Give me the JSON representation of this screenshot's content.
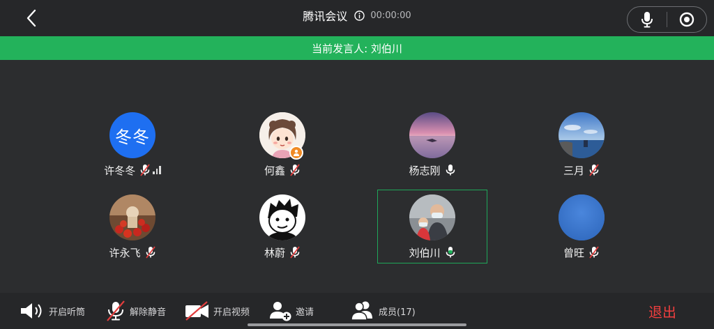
{
  "header": {
    "title": "腾讯会议",
    "timer": "00:00:00"
  },
  "speaker_bar": {
    "text": "当前发言人: 刘伯川"
  },
  "participants": [
    {
      "name": "许冬冬",
      "avatar_text": "冬冬",
      "mic": "muted",
      "signal": true
    },
    {
      "name": "何鑫",
      "mic": "muted",
      "host_badge": true
    },
    {
      "name": "杨志刚",
      "mic": "on"
    },
    {
      "name": "三月",
      "mic": "muted"
    },
    {
      "name": "许永飞",
      "mic": "muted"
    },
    {
      "name": "林蔚",
      "mic": "muted"
    },
    {
      "name": "刘伯川",
      "mic": "speaking",
      "active": true
    },
    {
      "name": "曾旺",
      "mic": "muted"
    }
  ],
  "toolbar": {
    "speaker_label": "开启听筒",
    "unmute_label": "解除静音",
    "video_label": "开启视频",
    "invite_label": "邀请",
    "members_label": "成员(17)",
    "leave_label": "退出"
  },
  "colors": {
    "background": "#2c2d2f",
    "bar": "#262729",
    "speaker_bar": "#23b25b",
    "speaking_mic": "#1fb05a",
    "muted_slash": "#e23d3d",
    "leave": "#ef3e3e",
    "avatar_blue": "#1e6ff1"
  }
}
